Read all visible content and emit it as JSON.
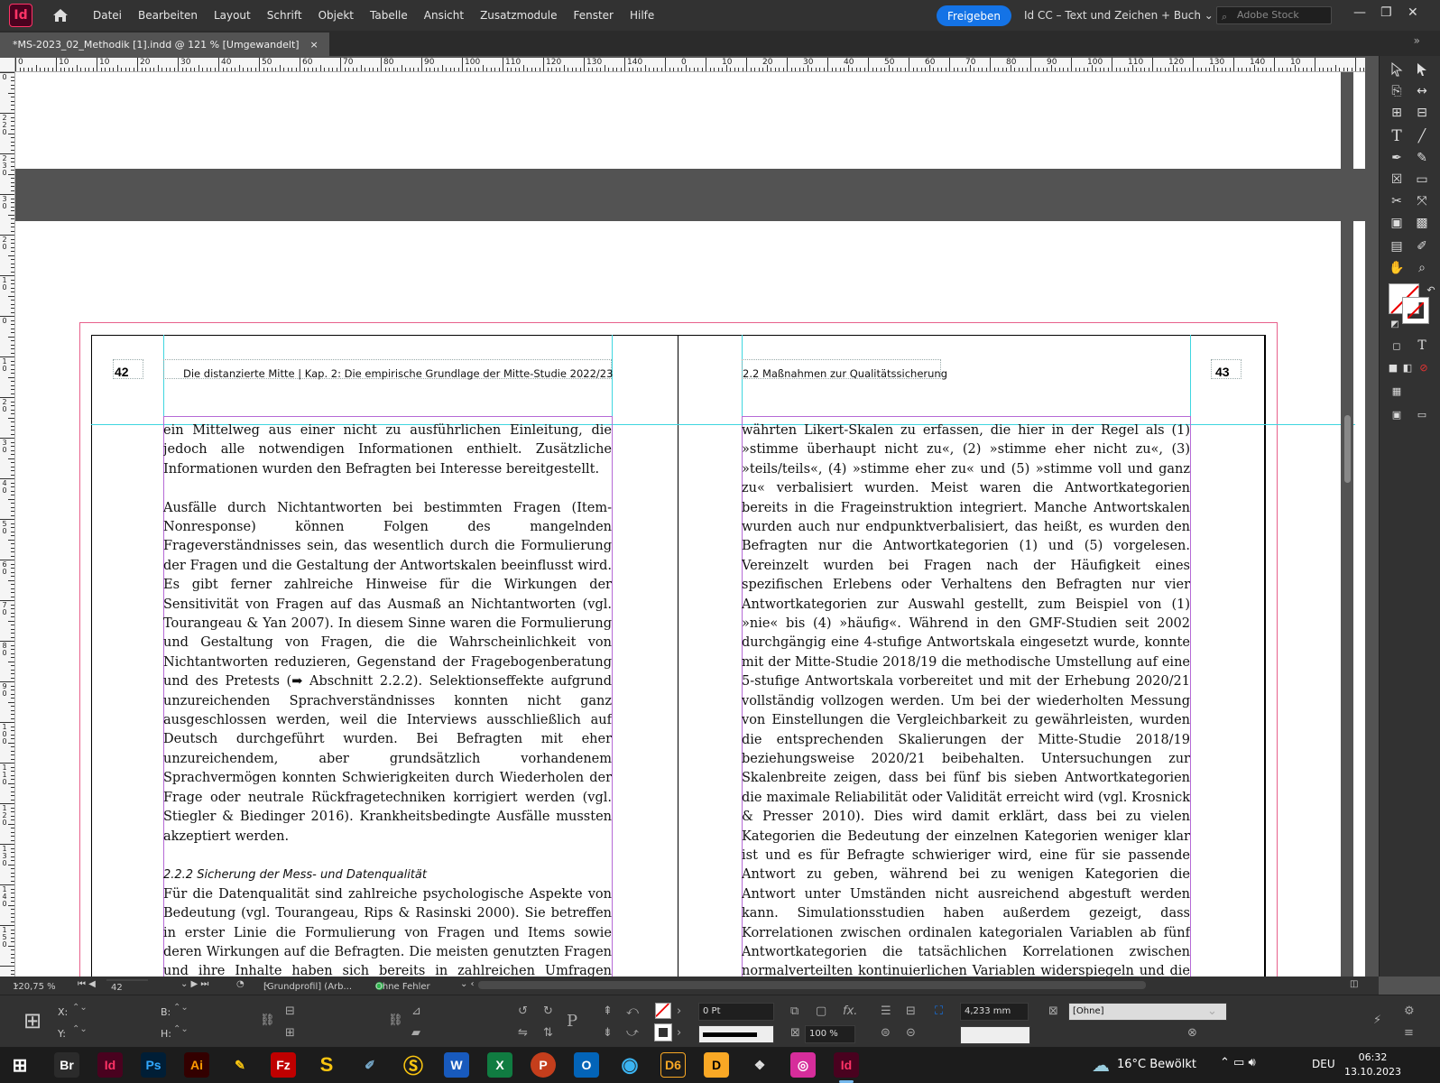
{
  "app": {
    "logo_text": "Id",
    "menu": [
      "Datei",
      "Bearbeiten",
      "Layout",
      "Schrift",
      "Objekt",
      "Tabelle",
      "Ansicht",
      "Zusatzmodule",
      "Fenster",
      "Hilfe"
    ],
    "share_label": "Freigeben",
    "workspace_label": "Id CC – Text und Zeichen + Buch",
    "stock_placeholder": "Adobe Stock"
  },
  "document_tab": {
    "title": "*MS-2023_02_Methodik [1].indd @ 121 % [Umgewandelt]",
    "close": "×"
  },
  "ruler": {
    "h_labels_left": [
      "0",
      "10",
      "10",
      "20",
      "30",
      "40",
      "50",
      "60",
      "70",
      "80",
      "90",
      "100",
      "110",
      "120",
      "130",
      "140"
    ],
    "h_labels_right": [
      "0",
      "10",
      "20",
      "30",
      "40",
      "50",
      "60",
      "70",
      "80",
      "90",
      "100",
      "110",
      "120",
      "130",
      "140",
      "10"
    ],
    "v_labels": [
      "0",
      "2 2 0",
      "2 3 0",
      "3 0",
      "2 0",
      "1 0",
      "0",
      "1 0",
      "2 0",
      "3 0",
      "4 0",
      "5 0",
      "6 0",
      "7 0",
      "8 0",
      "9 0",
      "1 0 0",
      "1 1 0",
      "1 2 0",
      "1 3 0",
      "1 4 0",
      "1 5 0"
    ]
  },
  "spread": {
    "left_page_number": "42",
    "right_page_number": "43",
    "left_header": "Die distanzierte Mitte | Kap. 2: Die empirische Grundlage der Mitte-Studie 2022/23",
    "right_header": "2.2 Maßnahmen zur Qualitätssicherung",
    "left_column": [
      "ein Mittelweg aus einer nicht zu ausführlichen Einleitung, die jedoch alle notwendigen Informationen enthielt. Zusätzliche Informationen wurden den Befragten bei Interesse bereitgestellt.",
      "",
      "Ausfälle durch Nichtantworten bei bestimmten Fragen (Item-Nonresponse) können Folgen des mangelnden Frageverständnisses sein, das wesentlich durch die Formulierung der Fragen und die Gestaltung der Antwortskalen beeinflusst wird. Es gibt ferner zahlreiche Hinweise für die Wirkungen der Sensitivität von Fragen auf das Ausmaß an Nichtantworten (vgl. Tourangeau & Yan 2007). In diesem Sinne waren die Formulierung und Gestaltung von Fragen, die die Wahrscheinlichkeit von Nichtantworten reduzieren, Gegenstand der Fragebogenberatung und des Pretests (➡ Abschnitt 2.2.2). Selektionseffekte aufgrund unzureichenden Sprachverständnisses konnten nicht ganz ausgeschlossen werden, weil die Interviews ausschließlich auf Deutsch durchgeführt wurden. Bei Befragten mit eher unzureichendem, aber grundsätzlich vorhandenem Sprachvermögen konnten Schwierigkeiten durch Wiederholen der Frage oder neutrale Rückfragetechniken korrigiert werden (vgl. Stiegler & Biedinger 2016). Krankheitsbedingte Ausfälle mussten akzeptiert werden.",
      "",
      "2.2.2 Sicherung der Mess- und Datenqualität",
      "Für die Datenqualität sind zahlreiche psychologische Aspekte von Bedeutung (vgl. Tourangeau, Rips & Rasinski 2000). Sie betreffen in erster Linie die Formulierung von Fragen und Items sowie deren Wirkungen auf die Befragten. Die meisten genutzten Fragen und ihre Inhalte haben sich bereits in zahlreichen Umfragen bewährt oder sollten aus Gründen der Vergleichbarkeit im Längsschnitt nicht verändert werden. Es empfahl sich, bereits bei der Gestaltung des Fragebogens auf die Qualität der Fragen und der Antwortskalen zu achten. Da bei den Inhalten der Mitte-Studien und den dort erhobenen Einstellungen mit"
    ],
    "right_column": "währten Likert-Skalen zu erfassen, die hier in der Regel als (1) »stimme überhaupt nicht zu«, (2) »stimme eher nicht zu«, (3) »teils/teils«, (4) »stimme eher zu« und (5) »stimme voll und ganz zu« verbalisiert wurden. Meist waren die Antwortkategorien bereits in die Frageinstruktion integriert. Manche Antwortskalen wurden auch nur endpunktverbalisiert, das heißt, es wurden den Befragten nur die Antwortkategorien (1) und (5) vorgelesen. Vereinzelt wurden bei Fragen nach der Häufigkeit eines spezifischen Erlebens oder Verhaltens den Befragten nur vier Antwortkategorien zur Auswahl gestellt, zum Beispiel von (1) »nie« bis (4) »häufig«. Während in den GMF-Studien seit 2002 durchgängig eine 4-stufige Antwortskala eingesetzt wurde, konnte mit der Mitte-Studie 2018/19 die methodische Umstellung auf eine 5-stufige Antwortskala vorbereitet und mit der Erhebung 2020/21 vollständig vollzogen werden. Um bei der wiederholten Messung von Einstellungen die Vergleichbarkeit zu gewährleisten, wurden die entsprechenden Skalierungen der Mitte-Studie 2018/19 beziehungsweise 2020/21 beibehalten. Untersuchungen zur Skalenbreite zeigen, dass bei fünf bis sieben Antwortkategorien die maximale Reliabilität oder Validität erreicht wird (vgl. Krosnick & Presser 2010). Dies wird damit erklärt, dass bei zu vielen Kategorien die Bedeutung der einzelnen Kategorien weniger klar ist und es für Befragte schwieriger wird, eine für sie passende Antwort zu geben, während bei zu wenigen Kategorien die Antwort unter Umständen nicht ausreichend abgestuft werden kann. Simulationsstudien haben außerdem gezeigt, dass Korrelationen zwischen ordinalen kategorialen Variablen ab fünf Antwortkategorien die tatsächlichen Korrelationen zwischen normalverteilten kontinuierlichen Variablen widerspiegeln und die Güte der Skalen steigt (vgl. Lozano et al. 2008; Lubke & Muthén 2009). Die vorgenommenen Verbalisierungen der Antwortkategorien sollten grundsätzlich auch einem schnelleren Verständnis und dem geringeren kognitiven Aufwand bei der Beantwortung der Fragen am Telefon nutzen (Krosnick & Fabrigar 1997). Gegenüber rein numerischen Kategorien, die für unterschied-"
  },
  "status": {
    "zoom": "120,75 %",
    "page": "42",
    "profile": "[Grundprofil] (Arb...",
    "preflight": "Ohne Fehler"
  },
  "control_panel": {
    "x_label": "X:",
    "y_label": "Y:",
    "w_label": "B:",
    "h_label": "H:",
    "stroke_weight": "0 Pt",
    "scale": "100 %",
    "column_width": "4,233 mm",
    "object_style": "[Ohne]"
  },
  "taskbar": {
    "apps": [
      "Br",
      "Id",
      "Ps",
      "Ai",
      "",
      "Fz",
      "S",
      "",
      "",
      "W",
      "X",
      "P",
      "O",
      "",
      "D6",
      "D",
      "",
      "",
      "Id"
    ],
    "weather": "16°C  Bewölkt",
    "lang": "DEU",
    "time": "06:32",
    "date": "13.10.2023"
  }
}
